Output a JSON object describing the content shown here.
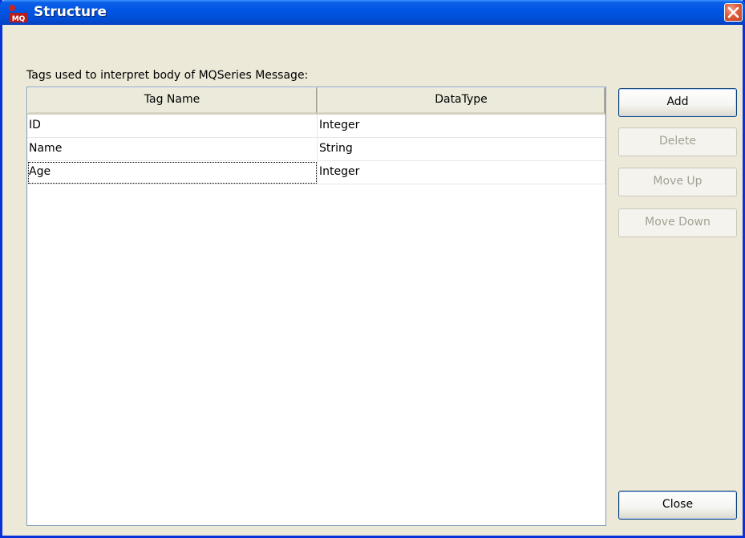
{
  "window": {
    "title": "Structure",
    "icon": "mq-icon"
  },
  "caption": "Tags used to interpret body of MQSeries Message:",
  "table": {
    "columns": [
      "Tag Name",
      "DataType"
    ],
    "rows": [
      {
        "tag": "ID",
        "type": "Integer"
      },
      {
        "tag": "Name",
        "type": "String"
      },
      {
        "tag": "Age",
        "type": "Integer"
      }
    ]
  },
  "buttons": {
    "add": "Add",
    "delete": "Delete",
    "move_up": "Move Up",
    "move_down": "Move Down",
    "close": "Close"
  },
  "colors": {
    "titlebar": "#0054e3",
    "face": "#ece9d8",
    "close_button": "#e0603f"
  }
}
